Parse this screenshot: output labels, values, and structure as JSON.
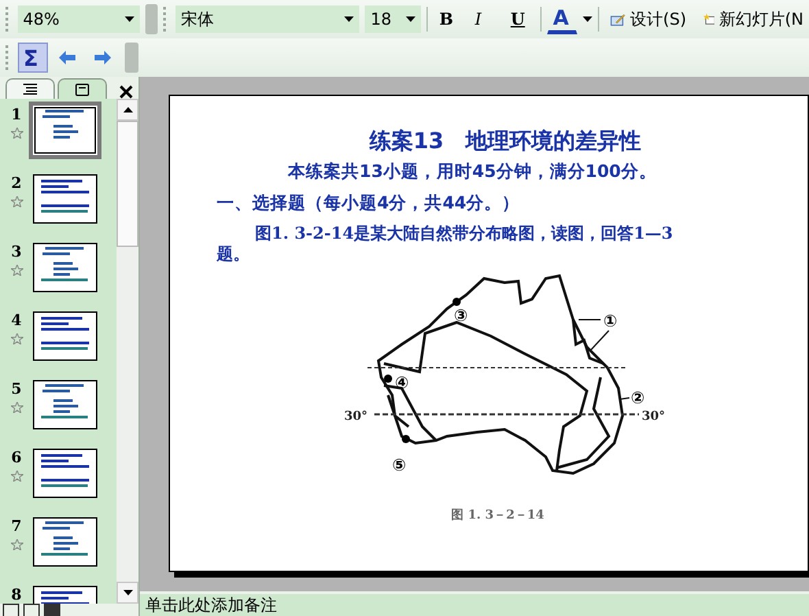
{
  "toolbar": {
    "zoom": "48%",
    "font": "宋体",
    "size": "18",
    "bold": "B",
    "italic": "I",
    "underline": "U",
    "font_color": "A",
    "design": "设计(S)",
    "new_slide": "新幻灯片(N"
  },
  "toolbar2": {
    "sum": "Σ",
    "sum_selected": true
  },
  "pane_tabs": [
    {
      "kind": "outline",
      "selected": false
    },
    {
      "kind": "slides",
      "selected": true
    }
  ],
  "slides": [
    {
      "number": "1",
      "selected": true
    },
    {
      "number": "2",
      "selected": false
    },
    {
      "number": "3",
      "selected": false
    },
    {
      "number": "4",
      "selected": false
    },
    {
      "number": "5",
      "selected": false
    },
    {
      "number": "6",
      "selected": false
    },
    {
      "number": "7",
      "selected": false
    },
    {
      "number": "8",
      "selected": false
    }
  ],
  "slide": {
    "title": "练案13　地理环境的差异性",
    "subtitle": "本练案共13小题，用时45分钟，满分100分。",
    "section": "一、选择题（每小题4分，共44分。）",
    "question": "图1. 3-2-14是某大陆自然带分布略图，读图，回答1—3题。",
    "figure": {
      "labels": [
        "①",
        "②",
        "③",
        "④",
        "⑤"
      ],
      "latitude": [
        "30°",
        "30°"
      ],
      "caption": "图 1. 3－2－14"
    }
  },
  "notes": {
    "placeholder": "单击此处添加备注"
  }
}
